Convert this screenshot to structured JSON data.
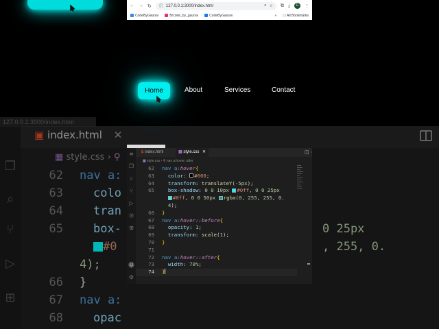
{
  "backdrop": {
    "strip": "127.0.0.1:3000/index.html",
    "tab_html": "index.html",
    "crumb": "style.css",
    "lines": [
      {
        "num": "62",
        "text": "nav a:"
      },
      {
        "num": "63",
        "text": "colo"
      },
      {
        "num": "64",
        "text": "tran"
      },
      {
        "num": "65",
        "text": "box-"
      },
      {
        "num": "",
        "text": "#0"
      },
      {
        "num": "",
        "text": "4);"
      },
      {
        "num": "66",
        "text": "}"
      },
      {
        "num": "67",
        "text": "nav a:"
      },
      {
        "num": "68",
        "text": "opac"
      }
    ],
    "right_fragments": [
      "0 25px",
      ", 255, 0."
    ]
  },
  "browser": {
    "url": "127.0.0.1:3000/index.html",
    "bookmarks": [
      "CodeByGaurav",
      "Brcode_by_gaurav",
      "CodeByGaurav"
    ],
    "all_bookmarks": "All Bookmarks",
    "avatar": "G"
  },
  "demo_nav": {
    "items": [
      "Home",
      "About",
      "Services",
      "Contact"
    ]
  },
  "vscode": {
    "tabs": [
      "index.html",
      "style.css"
    ],
    "breadcrumbs": [
      "style.css",
      "nav a:hover::after"
    ],
    "code": [
      {
        "n": "62",
        "t": "nav a:hover{"
      },
      {
        "n": "63",
        "t": "  color: #000;"
      },
      {
        "n": "64",
        "t": "  transform: translateY(-5px);"
      },
      {
        "n": "65",
        "t": "  box-shadow: 0 0 10px #0ff, 0 0 25px"
      },
      {
        "n": "",
        "t": "  #0ff, 0 0 50px rgba(0, 255, 255, 0."
      },
      {
        "n": "",
        "t": "  4);"
      },
      {
        "n": "66",
        "t": "}"
      },
      {
        "n": "67",
        "t": "nav a:hover::before{"
      },
      {
        "n": "68",
        "t": "  opacity: 1;"
      },
      {
        "n": "69",
        "t": "  transform: scale(1);"
      },
      {
        "n": "70",
        "t": "}"
      },
      {
        "n": "71",
        "t": ""
      },
      {
        "n": "72",
        "t": "nav a:hover::after{"
      },
      {
        "n": "73",
        "t": "  width: 70%;"
      },
      {
        "n": "74",
        "t": "}"
      }
    ]
  },
  "colors": {
    "accent": "#00ffff",
    "editor_bg": "#1e1e1e"
  }
}
